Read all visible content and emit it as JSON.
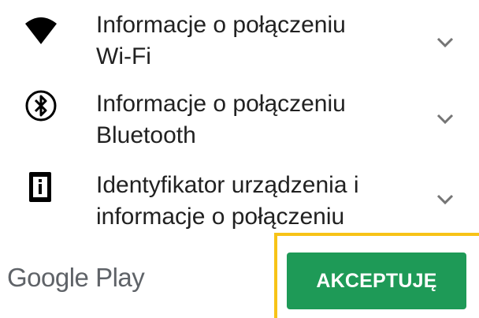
{
  "permissions": [
    {
      "icon": "wifi-icon",
      "label": "Informacje o połączeniu\nWi-Fi",
      "expand_icon": "chevron-down-icon"
    },
    {
      "icon": "bluetooth-icon",
      "label": "Informacje o połączeniu\nBluetooth",
      "expand_icon": "chevron-down-icon"
    },
    {
      "icon": "device-info-icon",
      "label": "Identyfikator urządzenia i\ninformacje o połączeniu",
      "expand_icon": "chevron-down-icon"
    }
  ],
  "footer": {
    "brand": "Google Play",
    "accept_label": "AKCEPTUJĘ"
  },
  "colors": {
    "accent_green": "#1e9a57",
    "highlight_yellow": "#f7c317",
    "text_primary": "#212121",
    "text_brand": "#5f6368"
  }
}
